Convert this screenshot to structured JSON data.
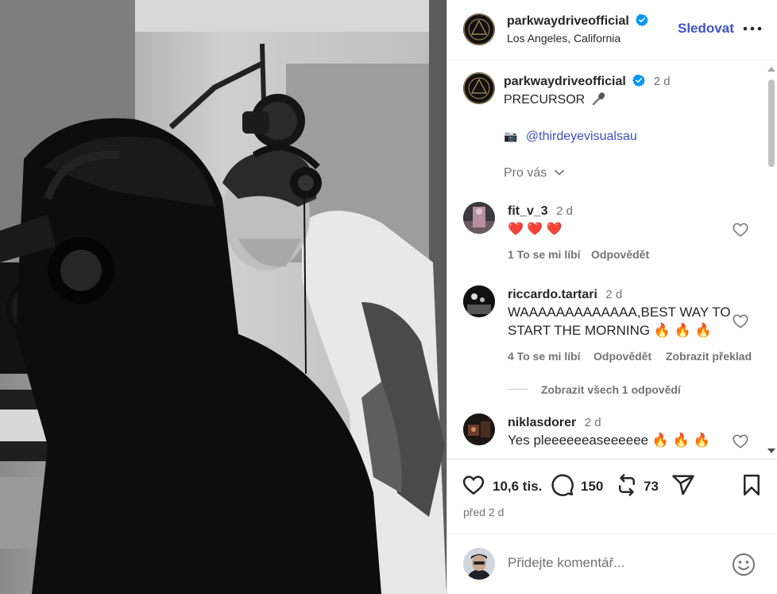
{
  "post": {
    "username": "parkwaydriveofficial",
    "location": "Los Angeles, California",
    "follow_label": "Sledovat",
    "caption": {
      "time": "2 d",
      "text": "PRECURSOR",
      "credit_emoji": "📷",
      "credit_mention": "@thirdeyevisualsau",
      "see_translation": "Pro vás"
    }
  },
  "comments": [
    {
      "username": "fit_v_3",
      "time": "2 d",
      "text": "❤️ ❤️ ❤️",
      "likes": "1 To se mi líbí",
      "reply": "Odpovědět"
    },
    {
      "username": "riccardo.tartari",
      "time": "2 d",
      "text_line1": "WAAAAAAAAAAAAA,BEST WAY TO",
      "text_line2": "START THE MORNING 🔥 🔥 🔥",
      "likes": "4 To se mi líbí",
      "reply": "Odpovědět",
      "translate": "Zobrazit překlad",
      "view_replies": "Zobrazit všech 1 odpovědí"
    },
    {
      "username": "niklasdorer",
      "time": "2 d",
      "text": "Yes pleeeeeeaseeeeee 🔥 🔥 🔥"
    }
  ],
  "actions": {
    "likes_count": "10,6 tis.",
    "comments_count": "150",
    "reposts_count": "73",
    "posted": "před 2 d"
  },
  "add_comment": {
    "placeholder": "Přidejte komentář..."
  },
  "colors": {
    "follow_blue": "#3f51c9",
    "link_blue": "#3a52c6",
    "verified_blue": "#0095f6",
    "muted": "#737373"
  },
  "icons": [
    "verified-icon",
    "more-icon",
    "mic-icon",
    "chevron-down-icon",
    "heart-icon",
    "comment-icon",
    "repost-icon",
    "share-icon",
    "bookmark-icon",
    "emoji-icon"
  ]
}
